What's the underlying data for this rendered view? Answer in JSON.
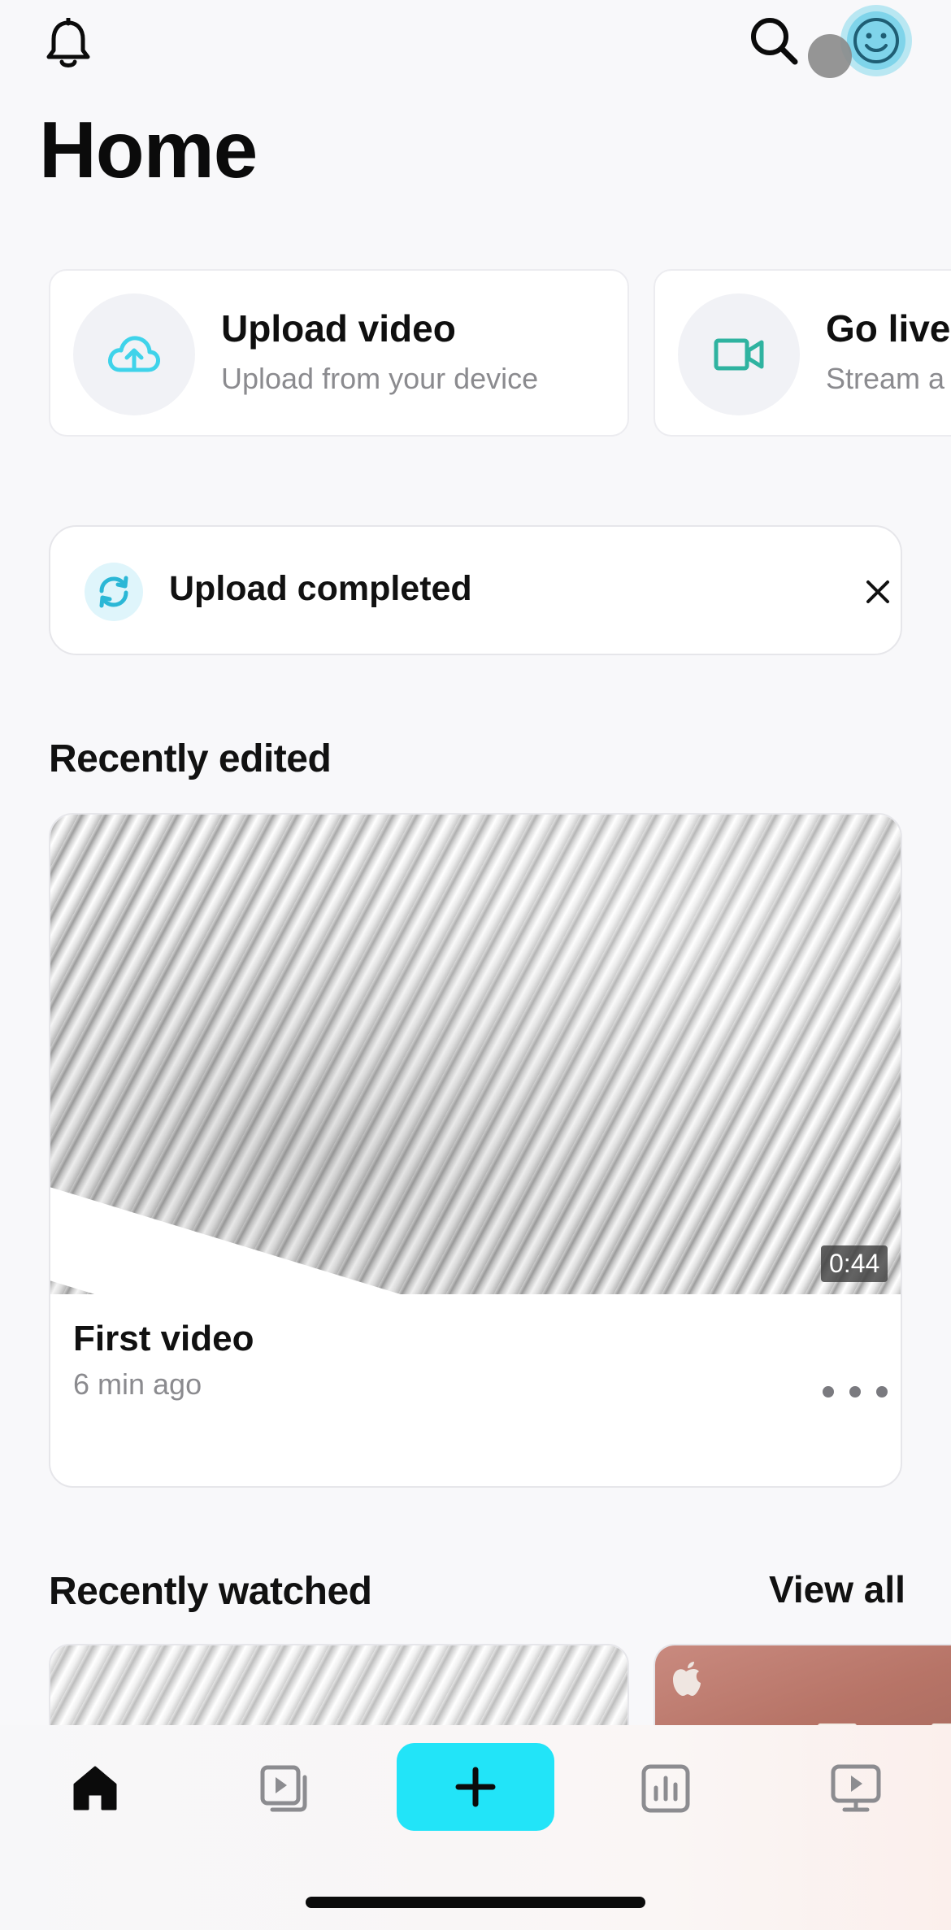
{
  "header": {
    "title": "Home",
    "icons": {
      "bell": "bell-icon",
      "search": "search-icon",
      "avatar": "avatar"
    }
  },
  "actions": [
    {
      "title": "Upload video",
      "subtitle": "Upload from your device",
      "icon": "cloud-upload-icon"
    },
    {
      "title": "Go live",
      "subtitle": "Stream a",
      "icon": "video-camera-icon"
    }
  ],
  "notice": {
    "text": "Upload completed",
    "icon": "sync-icon",
    "close_icon": "close-icon"
  },
  "recently_edited": {
    "heading": "Recently edited",
    "videos": [
      {
        "title": "First video",
        "time": "6 min ago",
        "duration": "0:44",
        "menu_icon": "more-horizontal-icon"
      }
    ]
  },
  "recently_watched": {
    "heading": "Recently watched",
    "view_all": "View all"
  },
  "tabbar": {
    "items": [
      "home-icon",
      "library-icon",
      "plus-icon",
      "stats-icon",
      "channel-icon"
    ],
    "selected": "home"
  },
  "colors": {
    "accent": "#22e4f8",
    "live_icon": "#2fb3a0",
    "upload_icon": "#3fd3ea"
  }
}
